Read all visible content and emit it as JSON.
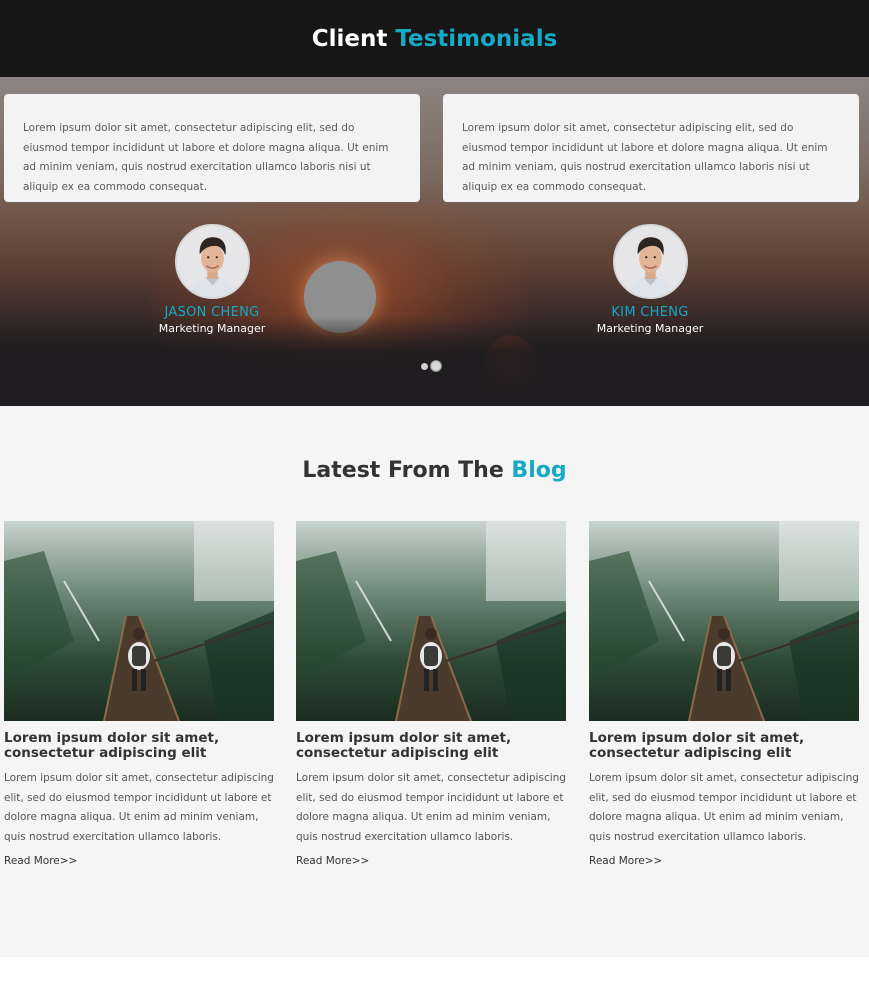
{
  "testimonials": {
    "title_main": "Client",
    "title_accent": "Testimonials",
    "items": [
      {
        "quote": "Lorem ipsum dolor sit amet, consectetur adipiscing elit, sed do eiusmod tempor incididunt ut labore et dolore magna aliqua. Ut enim ad minim veniam, quis nostrud exercitation ullamco laboris nisi ut aliquip ex ea commodo consequat.",
        "name": "JASON CHENG",
        "role": "Marketing Manager"
      },
      {
        "quote": "Lorem ipsum dolor sit amet, consectetur adipiscing elit, sed do eiusmod tempor incididunt ut labore et dolore magna aliqua. Ut enim ad minim veniam, quis nostrud exercitation ullamco laboris nisi ut aliquip ex ea commodo consequat.",
        "name": "KIM CHENG",
        "role": "Marketing Manager"
      }
    ],
    "pager": {
      "count": 2,
      "active_index": 1
    }
  },
  "blog": {
    "title_main": "Latest From The",
    "title_accent": "Blog",
    "posts": [
      {
        "title": "Lorem ipsum dolor sit amet, consectetur adipiscing elit",
        "body": "Lorem ipsum dolor sit amet, consectetur adipiscing elit, sed do eiusmod tempor incididunt ut labore et dolore magna aliqua. Ut enim ad minim veniam, quis nostrud exercitation ullamco laboris.",
        "link": "Read More>>"
      },
      {
        "title": "Lorem ipsum dolor sit amet, consectetur adipiscing elit",
        "body": "Lorem ipsum dolor sit amet, consectetur adipiscing elit, sed do eiusmod tempor incididunt ut labore et dolore magna aliqua. Ut enim ad minim veniam, quis nostrud exercitation ullamco laboris.",
        "link": "Read More>>"
      },
      {
        "title": "Lorem ipsum dolor sit amet, consectetur adipiscing elit",
        "body": "Lorem ipsum dolor sit amet, consectetur adipiscing elit, sed do eiusmod tempor incididunt ut labore et dolore magna aliqua. Ut enim ad minim veniam, quis nostrud exercitation ullamco laboris.",
        "link": "Read More>>"
      }
    ]
  },
  "colors": {
    "accent": "#16a9c5",
    "header_bg": "#161617",
    "blog_bg": "#f5f5f5",
    "card_bg": "#f3f3f3"
  }
}
